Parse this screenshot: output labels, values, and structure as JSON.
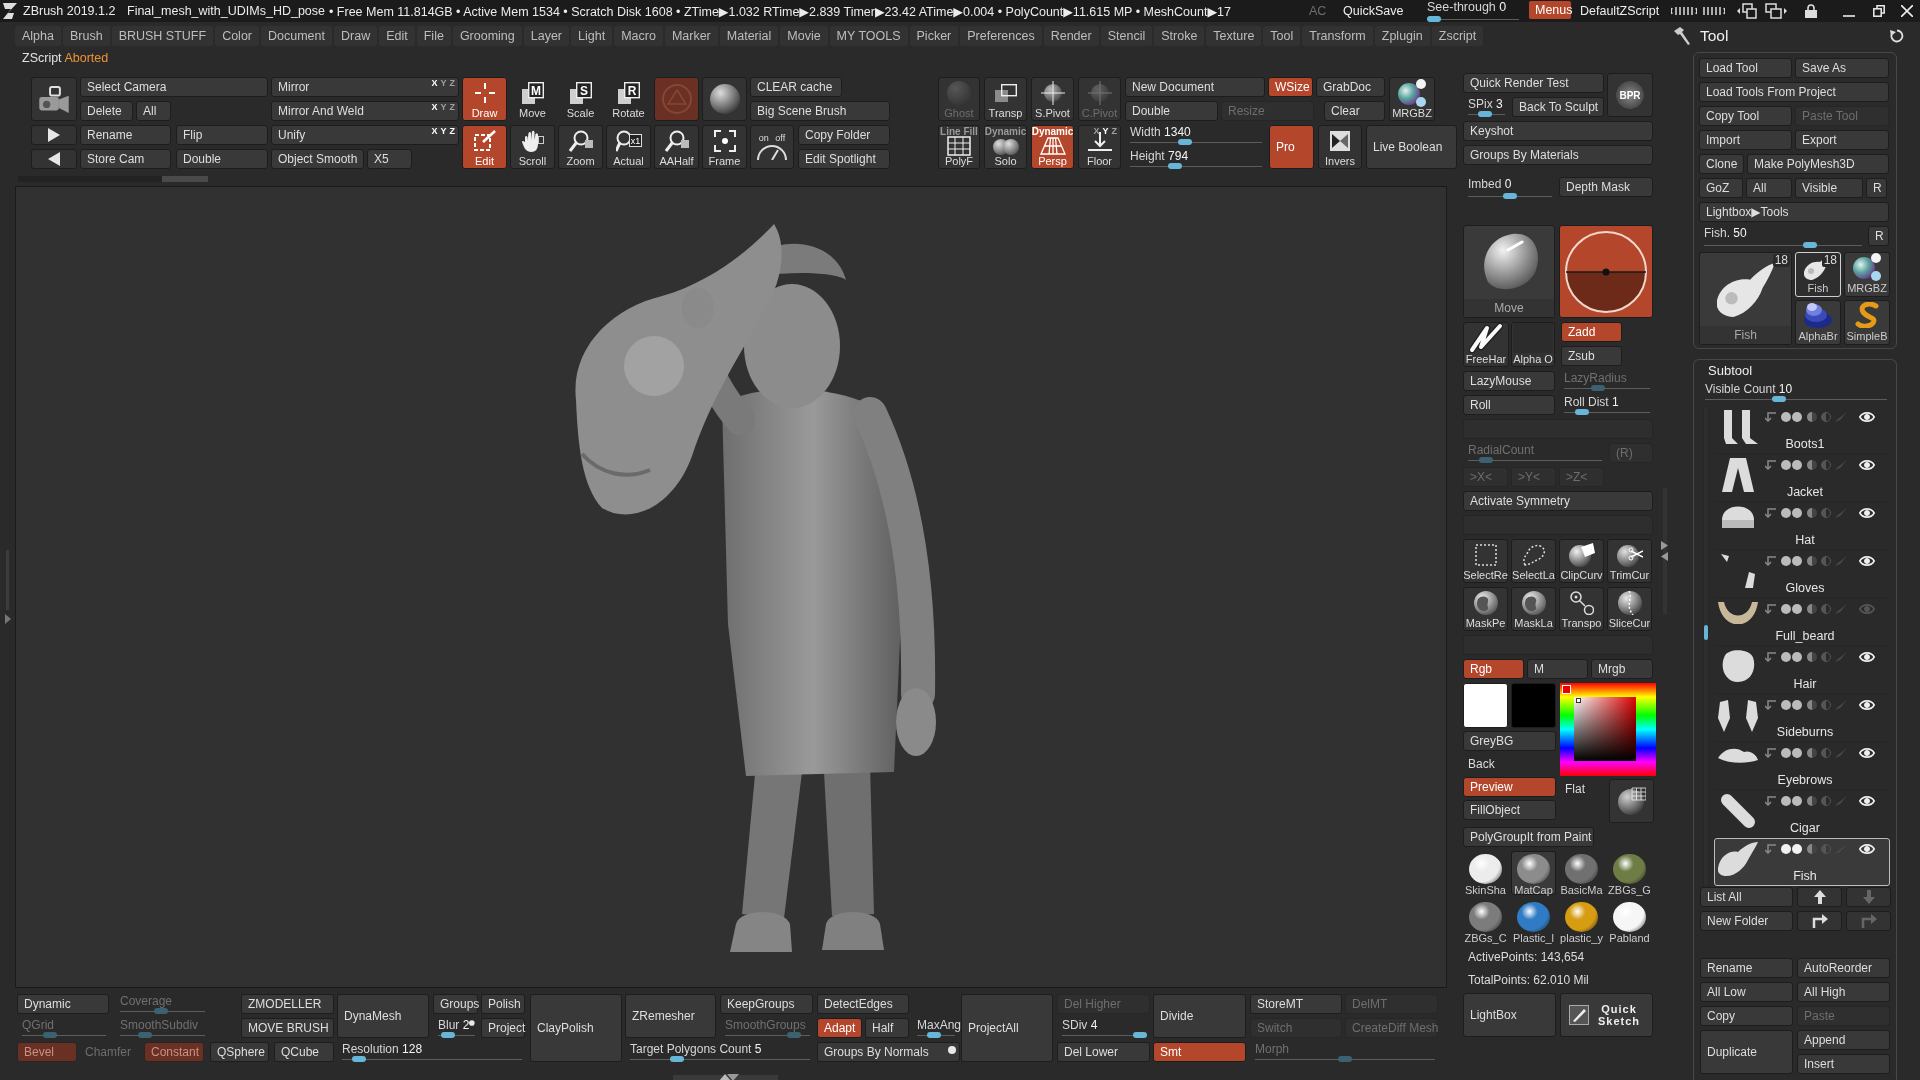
{
  "title_bar": {
    "app": "ZBrush 2019.1.2",
    "file": "Final_mesh_with_UDIMs_HD_pose",
    "stats": "• Free Mem 11.814GB • Active Mem 1534 • Scratch Disk 1608 • ZTime▶1.032 RTime▶2.839 Timer▶23.42 ATime▶0.004 • PolyCount▶11.615 MP • MeshCount▶17",
    "controls": [
      {
        "kind": "text",
        "label": "AC",
        "disabled": true
      },
      {
        "kind": "flat",
        "label": "QuickSave",
        "active": false,
        "disabled": false
      },
      {
        "kind": "slider",
        "label": "See-through",
        "value": "0",
        "level": 0,
        "disabled": false
      },
      {
        "kind": "button",
        "label": "Menus",
        "active": true,
        "disabled": false
      },
      {
        "kind": "flat",
        "label": "DefaultZScript",
        "active": false,
        "disabled": false
      }
    ]
  },
  "menu_bar": [
    "Alpha",
    "Brush",
    "BRUSH STUFF",
    "Color",
    "Document",
    "Draw",
    "Edit",
    "File",
    "Grooming",
    "Layer",
    "Light",
    "Macro",
    "Marker",
    "Material",
    "Movie",
    "MY TOOLS",
    "Picker",
    "Preferences",
    "Render",
    "Stencil",
    "Stroke",
    "Texture",
    "Tool",
    "Transform",
    "Zplugin",
    "Zscript"
  ],
  "zscript_status": {
    "label": "ZScript",
    "message": "Aborted"
  },
  "shelf_left": {
    "controls": [
      {
        "kind": "icon",
        "active": false,
        "disabled": false
      },
      {
        "kind": "icon",
        "active": false,
        "disabled": false
      },
      {
        "kind": "icon",
        "active": false,
        "disabled": false
      },
      {
        "kind": "button",
        "label": "Select Camera",
        "active": false,
        "disabled": false
      },
      {
        "kind": "button",
        "label": "Delete",
        "active": false,
        "disabled": false
      },
      {
        "kind": "button",
        "label": "All",
        "active": false,
        "disabled": false
      },
      {
        "kind": "button",
        "label": "Rename",
        "active": false,
        "disabled": false
      },
      {
        "kind": "button",
        "label": "Flip",
        "active": false,
        "disabled": false
      },
      {
        "kind": "button",
        "label": "Store Cam",
        "active": false,
        "disabled": false
      },
      {
        "kind": "button",
        "label": "Double",
        "active": false,
        "disabled": false
      },
      {
        "kind": "button",
        "label": "Mirror",
        "active": false,
        "disabled": false,
        "axes": [
          {
            "label": "X",
            "on": true
          },
          {
            "label": "Y",
            "on": false
          },
          {
            "label": "Z",
            "on": false
          }
        ]
      },
      {
        "kind": "button",
        "label": "Mirror And Weld",
        "active": false,
        "disabled": false,
        "axes": [
          {
            "label": "X",
            "on": true
          },
          {
            "label": "Y",
            "on": false
          },
          {
            "label": "Z",
            "on": false
          }
        ]
      },
      {
        "kind": "button",
        "label": "Unify",
        "active": false,
        "disabled": false,
        "axes": [
          {
            "label": "X",
            "on": true
          },
          {
            "label": "Y",
            "on": true
          },
          {
            "label": "Z",
            "on": true
          }
        ]
      },
      {
        "kind": "button",
        "label": "Object Smooth",
        "active": false,
        "disabled": false
      },
      {
        "kind": "button",
        "label": "X5",
        "active": false,
        "disabled": false
      },
      {
        "kind": "tool",
        "label": "Draw",
        "active": true,
        "disabled": false
      },
      {
        "kind": "tool",
        "label": "Edit",
        "active": true,
        "disabled": false
      },
      {
        "kind": "tool",
        "label": "Move",
        "glyph": "M",
        "active": false,
        "disabled": false
      },
      {
        "kind": "tool",
        "label": "Scroll",
        "active": false,
        "disabled": false
      },
      {
        "kind": "tool",
        "label": "Scale",
        "glyph": "S",
        "active": false,
        "disabled": false
      },
      {
        "kind": "tool",
        "label": "Zoom",
        "active": false,
        "disabled": false
      },
      {
        "kind": "tool",
        "label": "Rotate",
        "glyph": "R",
        "active": false,
        "disabled": false
      },
      {
        "kind": "tool",
        "label": "Actual",
        "glyph": "x1",
        "active": false,
        "disabled": false
      },
      {
        "kind": "icon",
        "active": true,
        "disabled": true
      },
      {
        "kind": "tool",
        "label": "AAHalf",
        "active": false,
        "disabled": false
      },
      {
        "kind": "icon",
        "active": false,
        "disabled": false
      },
      {
        "kind": "tool",
        "label": "Frame",
        "active": false,
        "disabled": false
      },
      {
        "kind": "button",
        "label": "CLEAR cache",
        "active": false,
        "disabled": false
      },
      {
        "kind": "button",
        "label": "Big Scene Brush",
        "active": false,
        "disabled": false
      },
      {
        "kind": "icon",
        "glyph": "on off",
        "active": false,
        "disabled": false
      },
      {
        "kind": "button",
        "label": "Copy Folder",
        "active": false,
        "disabled": false
      },
      {
        "kind": "button",
        "label": "Edit Spotlight",
        "active": false,
        "disabled": false
      }
    ]
  },
  "shelf_mid": {
    "controls": [
      {
        "kind": "tool",
        "label": "Ghost",
        "active": false,
        "disabled": true
      },
      {
        "kind": "tool",
        "top_label": "Line Fill",
        "label": "PolyF",
        "active": false,
        "disabled": false
      },
      {
        "kind": "tool",
        "label": "Transp",
        "active": false,
        "disabled": false
      },
      {
        "kind": "tool",
        "top_label": "Dynamic",
        "label": "Solo",
        "active": false,
        "disabled": false
      },
      {
        "kind": "tool",
        "label": "S.Pivot",
        "active": false,
        "disabled": false
      },
      {
        "kind": "tool",
        "top_label": "Dynamic",
        "label": "Persp",
        "active": true,
        "disabled": false
      },
      {
        "kind": "tool",
        "label": "C.Pivot",
        "active": false,
        "disabled": true
      },
      {
        "kind": "tool",
        "label": "Floor",
        "active": false,
        "disabled": false,
        "axes": [
          {
            "label": "X",
            "on": false
          },
          {
            "label": "Y",
            "on": true
          },
          {
            "label": "Z",
            "on": false
          }
        ]
      },
      {
        "kind": "button",
        "label": "New Document",
        "active": false,
        "disabled": false
      },
      {
        "kind": "button",
        "label": "WSize",
        "active": true,
        "disabled": false
      },
      {
        "kind": "button",
        "label": "GrabDoc",
        "active": false,
        "disabled": false
      },
      {
        "kind": "button",
        "label": "Double",
        "active": false,
        "disabled": false
      },
      {
        "kind": "button",
        "label": "Resize",
        "active": false,
        "disabled": true
      },
      {
        "kind": "button",
        "label": "Clear",
        "active": false,
        "disabled": false
      },
      {
        "kind": "tool",
        "label": "MRGBZ",
        "active": false,
        "disabled": false
      },
      {
        "kind": "slider",
        "label": "Width",
        "value": "1340",
        "level": 0.41,
        "disabled": false
      },
      {
        "kind": "slider",
        "label": "Height",
        "value": "794",
        "level": 0.32,
        "disabled": false
      },
      {
        "kind": "button",
        "label": "Pro",
        "active": true,
        "disabled": false
      },
      {
        "kind": "tool",
        "label": "Invers",
        "active": false,
        "disabled": false
      },
      {
        "kind": "button",
        "label": "Live Boolean",
        "active": false,
        "disabled": false
      }
    ]
  },
  "palette": {
    "controls": [
      {
        "kind": "button",
        "label": "Quick Render Test",
        "active": false,
        "disabled": false
      },
      {
        "kind": "slider",
        "label": "SPix",
        "value": "3",
        "level": 0.42,
        "disabled": false
      },
      {
        "kind": "button",
        "label": "Back To Sculpt",
        "active": false,
        "disabled": false
      },
      {
        "kind": "orb",
        "label": "BPR",
        "active": false,
        "disabled": false
      },
      {
        "kind": "button",
        "label": "Keyshot",
        "active": false,
        "disabled": false
      },
      {
        "kind": "button",
        "label": "Groups By Materials",
        "active": false,
        "disabled": false
      },
      {
        "kind": "slider",
        "label": "Imbed",
        "value": "0",
        "level": 0.5,
        "disabled": false
      },
      {
        "kind": "button",
        "label": "Depth Mask",
        "active": false,
        "disabled": false
      },
      {
        "kind": "thumb",
        "label": "Move",
        "selected": false
      },
      {
        "kind": "icon",
        "active": true,
        "disabled": false
      },
      {
        "kind": "tool",
        "label": "FreeHar",
        "active": false,
        "disabled": false
      },
      {
        "kind": "tool",
        "label": "Alpha O",
        "active": false,
        "disabled": false
      },
      {
        "kind": "button",
        "label": "Zadd",
        "active": true,
        "disabled": false
      },
      {
        "kind": "button",
        "label": "Zsub",
        "active": false,
        "disabled": false
      },
      {
        "kind": "button",
        "label": "LazyMouse",
        "active": false,
        "disabled": false
      },
      {
        "kind": "slider",
        "label": "LazyRadius",
        "level": 0.38,
        "disabled": true
      },
      {
        "kind": "button",
        "label": "Roll",
        "active": false,
        "disabled": false
      },
      {
        "kind": "slider",
        "label": "Roll Dist",
        "value": "1",
        "level": 0.15,
        "disabled": false
      },
      {
        "kind": "slider",
        "label": "RadialCount",
        "level": 0.09,
        "disabled": true
      },
      {
        "kind": "button",
        "label": "(R)",
        "active": false,
        "disabled": true
      },
      {
        "kind": "button",
        "label": ">X<",
        "active": false,
        "disabled": true
      },
      {
        "kind": "button",
        "label": ">Y<",
        "active": false,
        "disabled": true
      },
      {
        "kind": "button",
        "label": ">Z<",
        "active": false,
        "disabled": true
      },
      {
        "kind": "button",
        "label": "Activate Symmetry",
        "active": false,
        "disabled": false
      },
      {
        "kind": "tool",
        "label": "SelectRe",
        "active": false,
        "disabled": false
      },
      {
        "kind": "tool",
        "label": "SelectLa",
        "active": false,
        "disabled": false
      },
      {
        "kind": "tool",
        "label": "ClipCurv",
        "active": false,
        "disabled": false
      },
      {
        "kind": "tool",
        "label": "TrimCur",
        "active": false,
        "disabled": false
      },
      {
        "kind": "tool",
        "label": "MaskPe",
        "active": false,
        "disabled": false
      },
      {
        "kind": "tool",
        "label": "MaskLa",
        "active": false,
        "disabled": false
      },
      {
        "kind": "tool",
        "label": "Transpo",
        "active": false,
        "disabled": false
      },
      {
        "kind": "tool",
        "label": "SliceCur",
        "active": false,
        "disabled": false
      },
      {
        "kind": "button",
        "label": "Rgb",
        "active": true,
        "disabled": false
      },
      {
        "kind": "button",
        "label": "M",
        "active": false,
        "disabled": false
      },
      {
        "kind": "button",
        "label": "Mrgb",
        "active": false,
        "disabled": false
      },
      {
        "kind": "swatch",
        "color": "#ffffff"
      },
      {
        "kind": "swatch",
        "color": "#000000"
      },
      {
        "kind": "picker"
      },
      {
        "kind": "button",
        "label": "GreyBG",
        "active": false,
        "disabled": false
      },
      {
        "kind": "text",
        "label": "Back",
        "disabled": false
      },
      {
        "kind": "button",
        "label": "Preview",
        "active": true,
        "disabled": false
      },
      {
        "kind": "text",
        "label": "Flat",
        "disabled": false
      },
      {
        "kind": "icon",
        "active": false,
        "disabled": false
      },
      {
        "kind": "button",
        "label": "FillObject",
        "active": false,
        "disabled": false
      },
      {
        "kind": "button",
        "label": "PolyGroupIt from Paint",
        "active": false,
        "disabled": false
      },
      {
        "kind": "material",
        "label": "SkinSha",
        "color": "#ececec",
        "selected": false
      },
      {
        "kind": "material",
        "label": "MatCap",
        "color": "#8c8c8c",
        "selected": true
      },
      {
        "kind": "material",
        "label": "BasicMa",
        "color": "#707070",
        "selected": false
      },
      {
        "kind": "material",
        "label": "ZBGs_G",
        "color": "#6e7d46",
        "selected": false
      },
      {
        "kind": "material",
        "label": "ZBGs_C",
        "color": "#7c7c7c",
        "selected": false
      },
      {
        "kind": "material",
        "label": "Plastic_l",
        "color": "#2f7cc4",
        "selected": false
      },
      {
        "kind": "material",
        "label": "plastic_y",
        "color": "#d69c12",
        "selected": false
      },
      {
        "kind": "material",
        "label": "Pabland",
        "color": "#f6f6f6",
        "selected": false
      },
      {
        "kind": "text",
        "label": "ActivePoints: 143,654",
        "disabled": false
      },
      {
        "kind": "text",
        "label": "TotalPoints: 62.010 Mil",
        "disabled": false
      },
      {
        "kind": "button",
        "label": "LightBox",
        "active": false,
        "disabled": false
      },
      {
        "kind": "inline_tool",
        "label": "Quick Sketch",
        "active": false,
        "disabled": false
      }
    ]
  },
  "tool_panel": {
    "title": "Tool",
    "controls": [
      {
        "kind": "button",
        "label": "Load Tool",
        "active": false,
        "disabled": false
      },
      {
        "kind": "button",
        "label": "Save As",
        "active": false,
        "disabled": false
      },
      {
        "kind": "button",
        "label": "Load Tools From Project",
        "active": false,
        "disabled": false
      },
      {
        "kind": "button",
        "label": "Copy Tool",
        "active": false,
        "disabled": false
      },
      {
        "kind": "button",
        "label": "Paste Tool",
        "active": false,
        "disabled": true
      },
      {
        "kind": "button",
        "label": "Import",
        "active": false,
        "disabled": false
      },
      {
        "kind": "button",
        "label": "Export",
        "active": false,
        "disabled": false
      },
      {
        "kind": "button",
        "label": "Clone",
        "active": false,
        "disabled": false
      },
      {
        "kind": "button",
        "label": "Make PolyMesh3D",
        "active": false,
        "disabled": false
      },
      {
        "kind": "button",
        "label": "GoZ",
        "active": false,
        "disabled": false
      },
      {
        "kind": "button",
        "label": "All",
        "active": false,
        "disabled": false
      },
      {
        "kind": "button",
        "label": "Visible",
        "active": false,
        "disabled": false
      },
      {
        "kind": "button",
        "label": "R",
        "active": false,
        "disabled": false
      },
      {
        "kind": "button",
        "label": "Lightbox▶Tools",
        "active": false,
        "disabled": false
      },
      {
        "kind": "slider",
        "label": "Fish.",
        "value": "50",
        "level": 0.69,
        "disabled": false
      },
      {
        "kind": "button",
        "label": "R",
        "active": false,
        "disabled": false
      },
      {
        "kind": "thumb",
        "label": "Fish",
        "count": "18",
        "selected": false
      },
      {
        "kind": "thumb",
        "label": "Fish",
        "count": "18",
        "selected": true
      },
      {
        "kind": "thumb",
        "label": "MRGBZ",
        "selected": false
      },
      {
        "kind": "thumb",
        "label": "AlphaBr",
        "selected": false
      },
      {
        "kind": "thumb",
        "label": "SimpleB",
        "selected": false
      }
    ],
    "subtool": {
      "title": "Subtool",
      "visible_count": {
        "label": "Visible Count",
        "value": "10",
        "level": 0.4,
        "disabled": false
      },
      "items": [
        {
          "name": "Boots1",
          "selected": false,
          "visible": true
        },
        {
          "name": "Jacket",
          "selected": false,
          "visible": true
        },
        {
          "name": "Hat",
          "selected": false,
          "visible": true
        },
        {
          "name": "Gloves",
          "selected": false,
          "visible": true
        },
        {
          "name": "Full_beard",
          "selected": false,
          "visible": false
        },
        {
          "name": "Hair",
          "selected": false,
          "visible": true
        },
        {
          "name": "Sideburns",
          "selected": false,
          "visible": true
        },
        {
          "name": "Eyebrows",
          "selected": false,
          "visible": true
        },
        {
          "name": "Cigar",
          "selected": false,
          "visible": true
        },
        {
          "name": "Fish",
          "selected": true,
          "visible": true
        }
      ],
      "controls": [
        {
          "kind": "button",
          "label": "List All",
          "active": false,
          "disabled": false
        },
        {
          "kind": "icon",
          "active": false,
          "disabled": false
        },
        {
          "kind": "icon",
          "active": false,
          "disabled": true
        },
        {
          "kind": "button",
          "label": "New Folder",
          "active": false,
          "disabled": false
        },
        {
          "kind": "icon",
          "active": false,
          "disabled": false
        },
        {
          "kind": "icon",
          "active": false,
          "disabled": true
        },
        {
          "kind": "button",
          "label": "Rename",
          "active": false,
          "disabled": false
        },
        {
          "kind": "button",
          "label": "AutoReorder",
          "active": false,
          "disabled": false
        },
        {
          "kind": "button",
          "label": "All Low",
          "active": false,
          "disabled": false
        },
        {
          "kind": "button",
          "label": "All High",
          "active": false,
          "disabled": false
        },
        {
          "kind": "button",
          "label": "Copy",
          "active": false,
          "disabled": false
        },
        {
          "kind": "button",
          "label": "Paste",
          "active": false,
          "disabled": true
        },
        {
          "kind": "button",
          "label": "Append",
          "active": false,
          "disabled": false
        },
        {
          "kind": "button",
          "label": "Duplicate",
          "active": false,
          "disabled": false
        },
        {
          "kind": "button",
          "label": "Insert",
          "active": false,
          "disabled": false
        }
      ]
    }
  },
  "bottom_bar": {
    "controls": [
      {
        "kind": "button",
        "label": "Dynamic",
        "active": false,
        "disabled": false
      },
      {
        "kind": "slider",
        "label": "Coverage",
        "level": 0.48,
        "disabled": true
      },
      {
        "kind": "slider",
        "label": "QGrid",
        "level": 0.3,
        "disabled": true
      },
      {
        "kind": "slider",
        "label": "SmoothSubdiv",
        "level": 0.26,
        "disabled": true
      },
      {
        "kind": "button",
        "label": "Bevel",
        "active": true,
        "disabled": true
      },
      {
        "kind": "text",
        "label": "Chamfer",
        "disabled": true
      },
      {
        "kind": "button",
        "label": "Constant",
        "active": true,
        "disabled": true
      },
      {
        "kind": "button",
        "label": "ZMODELLER",
        "active": false,
        "disabled": false
      },
      {
        "kind": "button",
        "label": "MOVE BRUSH",
        "active": false,
        "disabled": false
      },
      {
        "kind": "button",
        "label": "QSphere",
        "active": false,
        "disabled": false
      },
      {
        "kind": "button",
        "label": "QCube",
        "active": false,
        "disabled": false
      },
      {
        "kind": "button",
        "label": "DynaMesh",
        "active": false,
        "disabled": false
      },
      {
        "kind": "button",
        "label": "Groups",
        "active": false,
        "disabled": false
      },
      {
        "kind": "button",
        "label": "Polish",
        "active": false,
        "disabled": false
      },
      {
        "kind": "slider",
        "label": "Blur",
        "value": "2",
        "level": 0.12,
        "disabled": false,
        "switch_on": true
      },
      {
        "kind": "button",
        "label": "Project",
        "active": false,
        "disabled": false
      },
      {
        "kind": "slider",
        "label": "Resolution",
        "value": "128",
        "level": 0.06,
        "disabled": false
      },
      {
        "kind": "button",
        "label": "ClayPolish",
        "active": false,
        "disabled": false
      },
      {
        "kind": "button",
        "label": "ZRemesher",
        "active": false,
        "disabled": false
      },
      {
        "kind": "button",
        "label": "KeepGroups",
        "active": false,
        "disabled": false
      },
      {
        "kind": "slider",
        "label": "SmoothGroups",
        "level": 0.88,
        "disabled": true
      },
      {
        "kind": "slider",
        "label": "Target Polygons Count",
        "value": "5",
        "level": 0.24,
        "disabled": false
      },
      {
        "kind": "button",
        "label": "DetectEdges",
        "active": false,
        "disabled": false
      },
      {
        "kind": "button",
        "label": "Adapt",
        "active": true,
        "disabled": false
      },
      {
        "kind": "button",
        "label": "Half",
        "active": false,
        "disabled": false
      },
      {
        "kind": "slider",
        "label": "MaxAng",
        "level": 0.43,
        "disabled": false
      },
      {
        "kind": "button",
        "label": "Groups By Normals",
        "active": false,
        "disabled": false,
        "switch_on": true
      },
      {
        "kind": "button",
        "label": "ProjectAll",
        "active": false,
        "disabled": false
      },
      {
        "kind": "button",
        "label": "Del Higher",
        "active": false,
        "disabled": true
      },
      {
        "kind": "slider",
        "label": "SDiv",
        "value": "4",
        "level": 1,
        "disabled": false
      },
      {
        "kind": "button",
        "label": "Del Lower",
        "active": false,
        "disabled": false
      },
      {
        "kind": "button",
        "label": "Divide",
        "active": false,
        "disabled": false
      },
      {
        "kind": "button",
        "label": "Smt",
        "active": true,
        "disabled": false
      },
      {
        "kind": "button",
        "label": "StoreMT",
        "active": false,
        "disabled": false
      },
      {
        "kind": "button",
        "label": "DelMT",
        "active": false,
        "disabled": true
      },
      {
        "kind": "button",
        "label": "Switch",
        "active": false,
        "disabled": true
      },
      {
        "kind": "button",
        "label": "CreateDiff Mesh",
        "active": false,
        "disabled": true
      },
      {
        "kind": "slider",
        "label": "Morph",
        "level": 0.5,
        "disabled": true
      }
    ]
  }
}
